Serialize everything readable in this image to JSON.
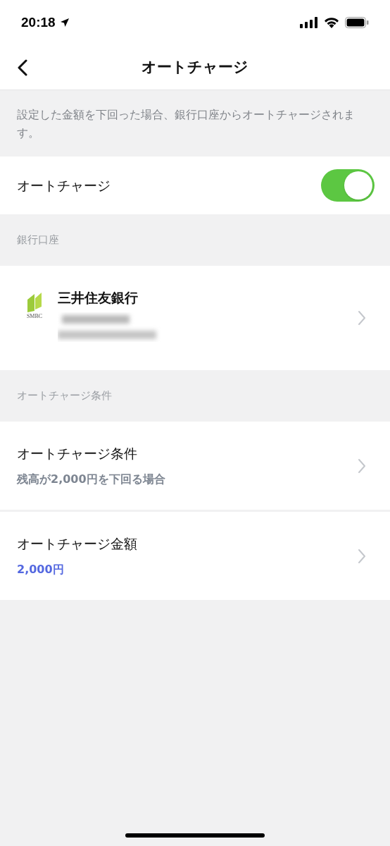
{
  "status_bar": {
    "time": "20:18"
  },
  "header": {
    "title": "オートチャージ"
  },
  "description": "設定した金額を下回った場合、銀行口座からオートチャージされます。",
  "auto_charge": {
    "label": "オートチャージ",
    "on": true
  },
  "sections": [
    {
      "title": "銀行口座",
      "rows": [
        {
          "kind": "bank",
          "title": "三井住友銀行",
          "logo_text": "SMBC"
        }
      ]
    },
    {
      "title": "オートチャージ条件",
      "rows": [
        {
          "kind": "setting",
          "title": "オートチャージ条件",
          "value": "残高が2,000円を下回る場合",
          "color": "#7d8591"
        },
        {
          "kind": "setting",
          "title": "オートチャージ金額",
          "value": "2,000円",
          "color": "#5468e0"
        }
      ]
    }
  ]
}
